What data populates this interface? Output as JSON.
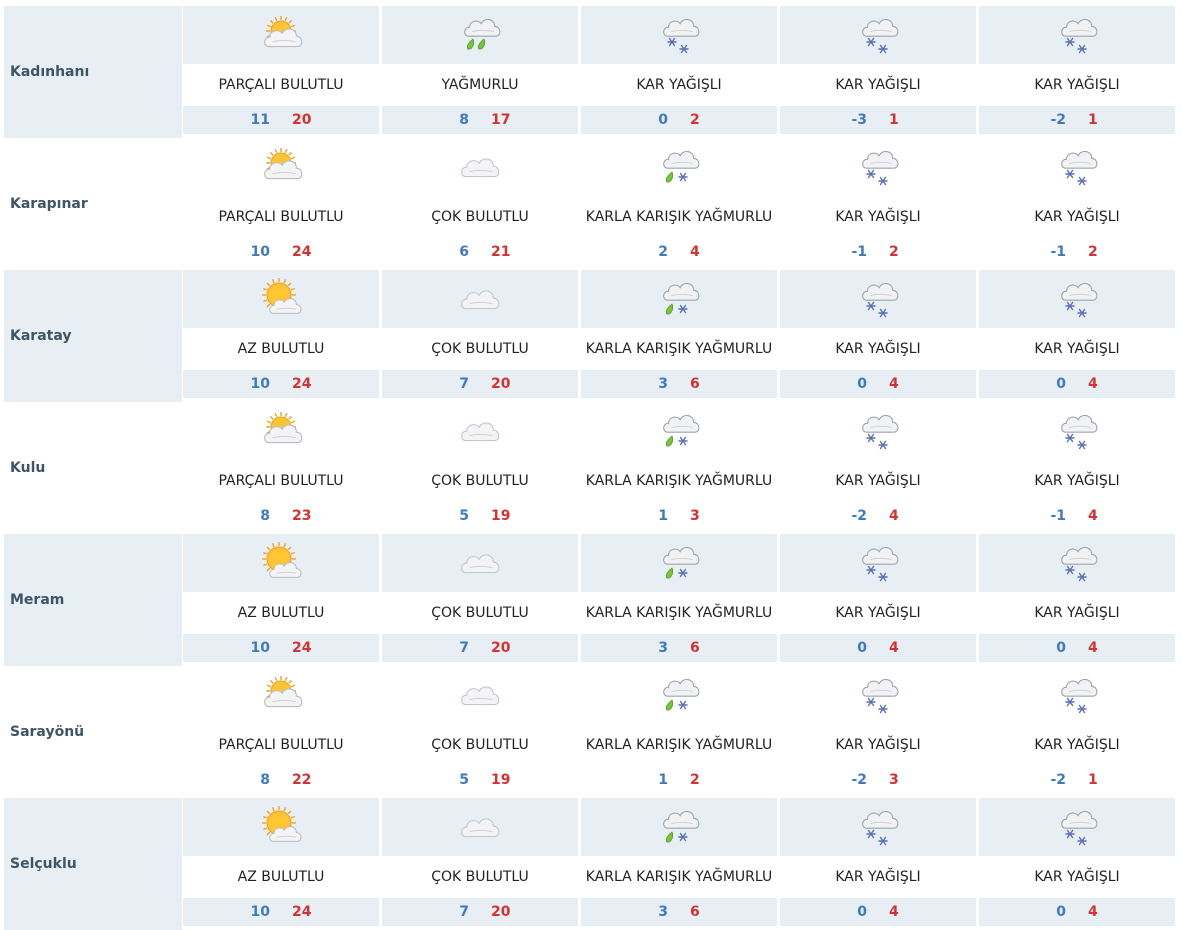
{
  "colors": {
    "row_alt_bg": "#e8eff4",
    "city_text": "#3d5566",
    "min_temp": "#3e7bbd",
    "max_temp": "#d63030"
  },
  "rows": [
    {
      "city": "Kadınhanı",
      "days": [
        {
          "icon": "partly-cloudy-icon",
          "desc": "PARÇALI BULUTLU",
          "min": "11",
          "max": "20"
        },
        {
          "icon": "rain-icon",
          "desc": "YAĞMURLU",
          "min": "8",
          "max": "17"
        },
        {
          "icon": "snow-icon",
          "desc": "KAR YAĞIŞLI",
          "min": "0",
          "max": "2"
        },
        {
          "icon": "snow-icon",
          "desc": "KAR YAĞIŞLI",
          "min": "-3",
          "max": "1"
        },
        {
          "icon": "snow-icon",
          "desc": "KAR YAĞIŞLI",
          "min": "-2",
          "max": "1"
        }
      ]
    },
    {
      "city": "Karapınar",
      "days": [
        {
          "icon": "partly-cloudy-icon",
          "desc": "PARÇALI BULUTLU",
          "min": "10",
          "max": "24"
        },
        {
          "icon": "cloudy-icon",
          "desc": "ÇOK BULUTLU",
          "min": "6",
          "max": "21"
        },
        {
          "icon": "sleet-icon",
          "desc": "KARLA KARIŞIK YAĞMURLU",
          "min": "2",
          "max": "4"
        },
        {
          "icon": "snow-icon",
          "desc": "KAR YAĞIŞLI",
          "min": "-1",
          "max": "2"
        },
        {
          "icon": "snow-icon",
          "desc": "KAR YAĞIŞLI",
          "min": "-1",
          "max": "2"
        }
      ]
    },
    {
      "city": "Karatay",
      "days": [
        {
          "icon": "mostly-sunny-icon",
          "desc": "AZ BULUTLU",
          "min": "10",
          "max": "24"
        },
        {
          "icon": "cloudy-icon",
          "desc": "ÇOK BULUTLU",
          "min": "7",
          "max": "20"
        },
        {
          "icon": "sleet-icon",
          "desc": "KARLA KARIŞIK YAĞMURLU",
          "min": "3",
          "max": "6"
        },
        {
          "icon": "snow-icon",
          "desc": "KAR YAĞIŞLI",
          "min": "0",
          "max": "4"
        },
        {
          "icon": "snow-icon",
          "desc": "KAR YAĞIŞLI",
          "min": "0",
          "max": "4"
        }
      ]
    },
    {
      "city": "Kulu",
      "days": [
        {
          "icon": "partly-cloudy-icon",
          "desc": "PARÇALI BULUTLU",
          "min": "8",
          "max": "23"
        },
        {
          "icon": "cloudy-icon",
          "desc": "ÇOK BULUTLU",
          "min": "5",
          "max": "19"
        },
        {
          "icon": "sleet-icon",
          "desc": "KARLA KARIŞIK YAĞMURLU",
          "min": "1",
          "max": "3"
        },
        {
          "icon": "snow-icon",
          "desc": "KAR YAĞIŞLI",
          "min": "-2",
          "max": "4"
        },
        {
          "icon": "snow-icon",
          "desc": "KAR YAĞIŞLI",
          "min": "-1",
          "max": "4"
        }
      ]
    },
    {
      "city": "Meram",
      "days": [
        {
          "icon": "mostly-sunny-icon",
          "desc": "AZ BULUTLU",
          "min": "10",
          "max": "24"
        },
        {
          "icon": "cloudy-icon",
          "desc": "ÇOK BULUTLU",
          "min": "7",
          "max": "20"
        },
        {
          "icon": "sleet-icon",
          "desc": "KARLA KARIŞIK YAĞMURLU",
          "min": "3",
          "max": "6"
        },
        {
          "icon": "snow-icon",
          "desc": "KAR YAĞIŞLI",
          "min": "0",
          "max": "4"
        },
        {
          "icon": "snow-icon",
          "desc": "KAR YAĞIŞLI",
          "min": "0",
          "max": "4"
        }
      ]
    },
    {
      "city": "Sarayönü",
      "days": [
        {
          "icon": "partly-cloudy-icon",
          "desc": "PARÇALI BULUTLU",
          "min": "8",
          "max": "22"
        },
        {
          "icon": "cloudy-icon",
          "desc": "ÇOK BULUTLU",
          "min": "5",
          "max": "19"
        },
        {
          "icon": "sleet-icon",
          "desc": "KARLA KARIŞIK YAĞMURLU",
          "min": "1",
          "max": "2"
        },
        {
          "icon": "snow-icon",
          "desc": "KAR YAĞIŞLI",
          "min": "-2",
          "max": "3"
        },
        {
          "icon": "snow-icon",
          "desc": "KAR YAĞIŞLI",
          "min": "-2",
          "max": "1"
        }
      ]
    },
    {
      "city": "Selçuklu",
      "days": [
        {
          "icon": "mostly-sunny-icon",
          "desc": "AZ BULUTLU",
          "min": "10",
          "max": "24"
        },
        {
          "icon": "cloudy-icon",
          "desc": "ÇOK BULUTLU",
          "min": "7",
          "max": "20"
        },
        {
          "icon": "sleet-icon",
          "desc": "KARLA KARIŞIK YAĞMURLU",
          "min": "3",
          "max": "6"
        },
        {
          "icon": "snow-icon",
          "desc": "KAR YAĞIŞLI",
          "min": "0",
          "max": "4"
        },
        {
          "icon": "snow-icon",
          "desc": "KAR YAĞIŞLI",
          "min": "0",
          "max": "4"
        }
      ]
    }
  ]
}
